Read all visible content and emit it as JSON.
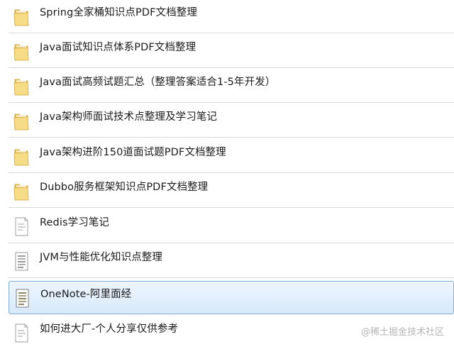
{
  "items": [
    {
      "label": "Spring全家桶知识点PDF文档整理",
      "icon": "folder-icon",
      "type": "folder"
    },
    {
      "label": "Java面试知识点体系PDF文档整理",
      "icon": "folder-icon",
      "type": "folder"
    },
    {
      "label": "Java面试高频试题汇总（整理答案适合1-5年开发）",
      "icon": "folder-icon",
      "type": "folder"
    },
    {
      "label": "Java架构师面试技术点整理及学习笔记",
      "icon": "folder-icon",
      "type": "folder"
    },
    {
      "label": "Java架构进阶150道面试题PDF文档整理",
      "icon": "folder-icon",
      "type": "folder"
    },
    {
      "label": "Dubbo服务框架知识点PDF文档整理",
      "icon": "folder-icon",
      "type": "folder"
    },
    {
      "label": "Redis学习笔记",
      "icon": "text-file-icon",
      "type": "file"
    },
    {
      "label": "JVM与性能优化知识点整理",
      "icon": "document-icon",
      "type": "file"
    },
    {
      "label": "OneNote-阿里面经",
      "icon": "document-icon",
      "type": "file",
      "selected": true
    },
    {
      "label": "如何进大厂-个人分享仅供参考",
      "icon": "text-file-icon",
      "type": "file"
    }
  ],
  "watermark": "@稀土掘金技术社区",
  "colors": {
    "selection_bg": "#d7e9fb",
    "selection_border": "#84acdd",
    "folder_fill": "#f3d476",
    "divider": "#d9d9d9"
  }
}
